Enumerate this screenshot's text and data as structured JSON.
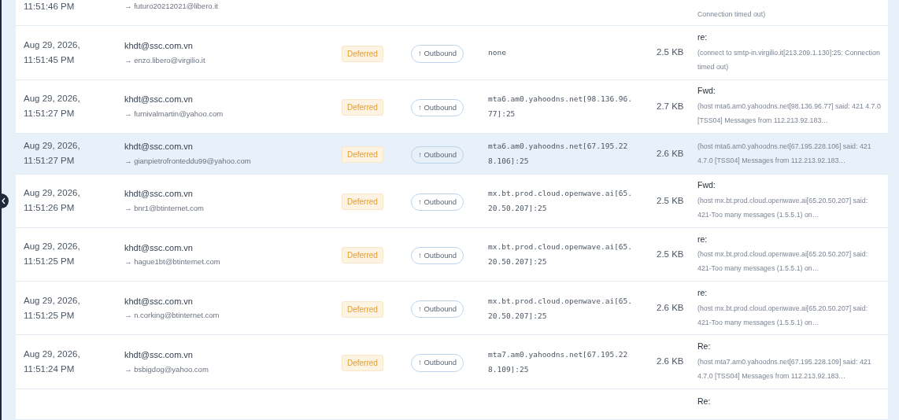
{
  "partial_top_row": {
    "time": "11:51:46 PM",
    "recipient": "→ futuro20212021@libero.it",
    "detail": "Connection timed out)"
  },
  "rows": [
    {
      "date": "Aug 29, 2026,",
      "time": "11:51:45 PM",
      "sender": "khdt@ssc.com.vn",
      "recipient": "→ enzo.libero@virgilio.it",
      "status": "Deferred",
      "direction": "↑ Outbound",
      "relay": "none",
      "size": "2.5 KB",
      "subject": "re:",
      "detail": "(connect to smtp-in.virgilio.it[213.209.1.130]:25: Connection timed out)",
      "selected": false
    },
    {
      "date": "Aug 29, 2026,",
      "time": "11:51:27 PM",
      "sender": "khdt@ssc.com.vn",
      "recipient": "→ furnivalmartin@yahoo.com",
      "status": "Deferred",
      "direction": "↑ Outbound",
      "relay": "mta6.am0.yahoodns.net[98.136.96.77]:25",
      "size": "2.7 KB",
      "subject": "Fwd:",
      "detail": "(host mta6.am0.yahoodns.net[98.136.96.77] said: 421 4.7.0 [TSS04] Messages from 112.213.92.183…",
      "selected": false
    },
    {
      "date": "Aug 29, 2026,",
      "time": "11:51:27 PM",
      "sender": "khdt@ssc.com.vn",
      "recipient": "→ gianpietrofronteddu99@yahoo.com",
      "status": "Deferred",
      "direction": "↑ Outbound",
      "relay": "mta6.am0.yahoodns.net[67.195.228.106]:25",
      "size": "2.6 KB",
      "detail": "(host mta6.am0.yahoodns.net[67.195.228.106] said: 421 4.7.0 [TSS04] Messages from 112.213.92.183…",
      "selected": true
    },
    {
      "date": "Aug 29, 2026,",
      "time": "11:51:26 PM",
      "sender": "khdt@ssc.com.vn",
      "recipient": "→ bnr1@btinternet.com",
      "status": "Deferred",
      "direction": "↑ Outbound",
      "relay": "mx.bt.prod.cloud.openwave.ai[65.20.50.207]:25",
      "size": "2.5 KB",
      "subject": "Fwd:",
      "detail": "(host mx.bt.prod.cloud.openwave.ai[65.20.50.207] said: 421-Too many messages (1.5.5.1) on…",
      "selected": false
    },
    {
      "date": "Aug 29, 2026,",
      "time": "11:51:25 PM",
      "sender": "khdt@ssc.com.vn",
      "recipient": "→ hague1bt@btinternet.com",
      "status": "Deferred",
      "direction": "↑ Outbound",
      "relay": "mx.bt.prod.cloud.openwave.ai[65.20.50.207]:25",
      "size": "2.5 KB",
      "subject": "re:",
      "detail": "(host mx.bt.prod.cloud.openwave.ai[65.20.50.207] said: 421-Too many messages (1.5.5.1) on…",
      "selected": false
    },
    {
      "date": "Aug 29, 2026,",
      "time": "11:51:25 PM",
      "sender": "khdt@ssc.com.vn",
      "recipient": "→ n.corking@btinternet.com",
      "status": "Deferred",
      "direction": "↑ Outbound",
      "relay": "mx.bt.prod.cloud.openwave.ai[65.20.50.207]:25",
      "size": "2.6 KB",
      "subject": "re:",
      "detail": "(host mx.bt.prod.cloud.openwave.ai[65.20.50.207] said: 421-Too many messages (1.5.5.1) on…",
      "selected": false
    },
    {
      "date": "Aug 29, 2026,",
      "time": "11:51:24 PM",
      "sender": "khdt@ssc.com.vn",
      "recipient": "→ bsbigdog@yahoo.com",
      "status": "Deferred",
      "direction": "↑ Outbound",
      "relay": "mta7.am0.yahoodns.net[67.195.228.109]:25",
      "size": "2.6 KB",
      "subject": "Re:",
      "detail": "(host mta7.am0.yahoodns.net[67.195.228.109] said: 421 4.7.0 [TSS04] Messages from 112.213.92.183…",
      "selected": false
    }
  ],
  "partial_bottom_row": {
    "subject": "Re:"
  }
}
